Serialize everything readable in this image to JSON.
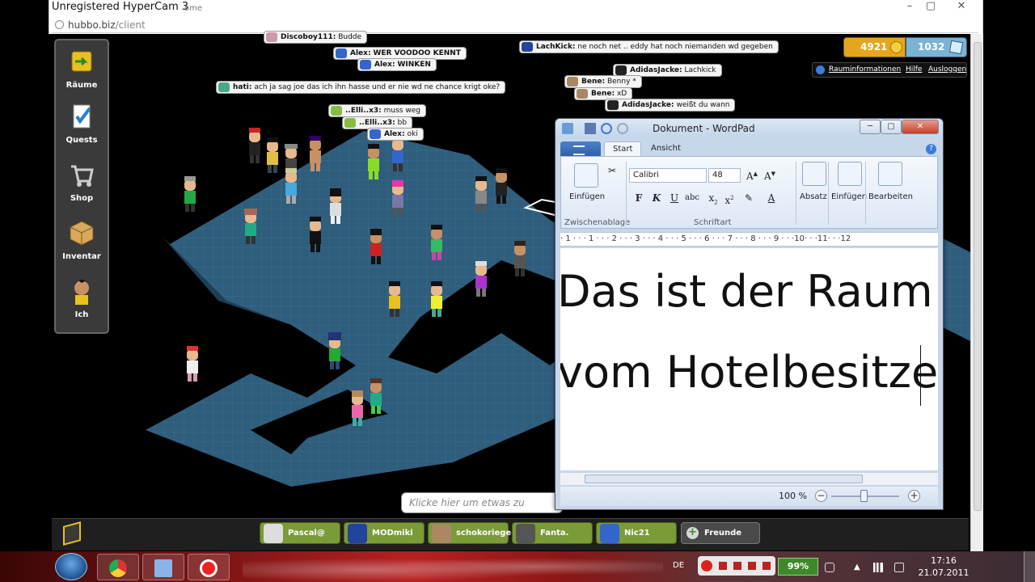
{
  "recorder": {
    "watermark": "Unregistered HyperCam 3"
  },
  "browser": {
    "url_host": "hubbo.biz",
    "url_path": "/client",
    "title_faint": "ome"
  },
  "nav": {
    "items": [
      {
        "label": "Räume",
        "icon": "rooms-icon"
      },
      {
        "label": "Quests",
        "icon": "quests-icon"
      },
      {
        "label": "Shop",
        "icon": "shop-icon"
      },
      {
        "label": "Inventar",
        "icon": "inventory-icon"
      },
      {
        "label": "Ich",
        "icon": "avatar-icon"
      }
    ]
  },
  "chat": [
    {
      "user": "Discoboy111:",
      "text": "Budde"
    },
    {
      "user": "Alex:",
      "text": "WER VOODOO KENNT"
    },
    {
      "user": "Alex:",
      "text": "WINKEN"
    },
    {
      "user": "hati:",
      "text": "ach ja sag joe das ich ihn hasse und er nie wd ne chance krigt oke?"
    },
    {
      "user": "..Elli..x3:",
      "text": "muss weg"
    },
    {
      "user": "..Elli..x3:",
      "text": "bb"
    },
    {
      "user": "Alex:",
      "text": "oki"
    },
    {
      "user": "LachKick:",
      "text": "ne noch net .. eddy hat noch niemanden wd gegeben"
    },
    {
      "user": "AdidasJacke:",
      "text": "Lachkick"
    },
    {
      "user": "Bene:",
      "text": "Benny *"
    },
    {
      "user": "Bene:",
      "text": "xD"
    },
    {
      "user": "AdidasJacke:",
      "text": "weißt du wann"
    }
  ],
  "currency": {
    "credits": "4921",
    "pixels": "1032"
  },
  "room_links": {
    "info": "Rauminformationen",
    "help": "Hilfe",
    "logout": "Ausloggen"
  },
  "chat_input": {
    "placeholder": "Klicke hier um etwas zu sagen..."
  },
  "friends_bar": {
    "friends": [
      "Pascal@",
      "MODmiki",
      "schokoriegel",
      "Fanta.",
      "Nic21"
    ],
    "friends_button": "Freunde"
  },
  "wordpad": {
    "title": "Dokument - WordPad",
    "tabs": [
      "Start",
      "Ansicht"
    ],
    "ribbon": {
      "paste": "Einfügen",
      "clipboard_group": "Zwischenablage",
      "font_name": "Calibri",
      "font_size": "48",
      "font_group": "Schriftart",
      "paragraph": "Absatz",
      "insert": "Einfügen",
      "edit": "Bearbeiten",
      "bold": "F",
      "italic": "K",
      "underline": "U",
      "strike": "abc"
    },
    "ruler": "· 1 · · · 1 · · · 2 · · · 3 · · · 4 · · · 5 · · · 6 · · · 7 · · · 8 · · · 9 · · ·10· · ·11· · ·12",
    "doc_lines": [
      "Das ist der Raum",
      "vom Hotelbesitze"
    ],
    "zoom": "100 %"
  },
  "taskbar": {
    "lang": "DE",
    "battery": "99%",
    "time": "17:16",
    "date": "21.07.2011"
  },
  "colors": {
    "room_floor": "#2d5b78",
    "bubble_bg": "#f4f4f4",
    "toolbar_green": "#7b9a38",
    "credits_gold": "#e6a51e",
    "pixels_blue": "#7ab3d3"
  }
}
